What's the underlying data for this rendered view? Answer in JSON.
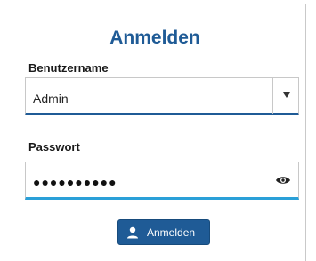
{
  "form": {
    "title": "Anmelden",
    "username_label": "Benutzername",
    "username_value": "Admin",
    "password_label": "Passwort",
    "password_masked": "●●●●●●●●●●",
    "submit_label": "Anmelden"
  },
  "icons": {
    "dropdown": "chevron-down-icon",
    "show_password": "eye-icon",
    "submit": "user-icon"
  },
  "colors": {
    "accent": "#1f5b96",
    "focus": "#2aa0d8"
  }
}
